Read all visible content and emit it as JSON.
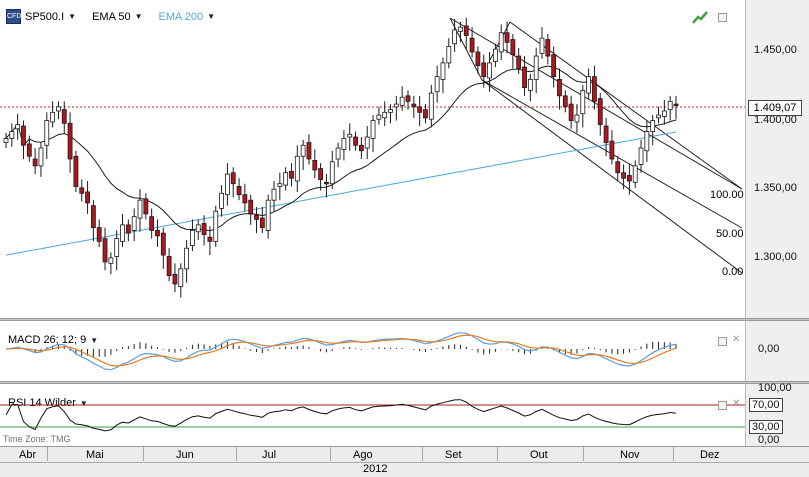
{
  "header": {
    "symbol": "SP500.I",
    "ema50": "EMA 50",
    "ema200": "EMA 200",
    "colors": {
      "ema50": "#1a1a1a",
      "ema200": "#4ea8dc",
      "bull": "#ffffff",
      "bear": "#b0161c"
    }
  },
  "price_axis": {
    "ticks": [
      "1.450,00",
      "1.400,00",
      "1.350,00",
      "1.300,00"
    ],
    "last_price": "1.409,07"
  },
  "fib_labels": [
    "100.00",
    "50.00",
    "0.00"
  ],
  "macd": {
    "label": "MACD 26; 12; 9",
    "tick": "0,00",
    "colors": {
      "macd": "#5d9fd6",
      "signal": "#e07f2a",
      "fill": "#b6dcef"
    }
  },
  "rsi": {
    "label": "RSI 14 Wilder",
    "ticks": [
      "100,00",
      "70,00",
      "30,00",
      "0,00"
    ],
    "colors": {
      "upper": "#a32020",
      "lower": "#4a9a4a"
    }
  },
  "time_axis": {
    "months": [
      "Abr",
      "Mai",
      "Jun",
      "Jul",
      "Ago",
      "Set",
      "Out",
      "Nov",
      "Dez"
    ],
    "year": "2012",
    "time_zone": "Time Zone: TMG"
  },
  "chart_data": {
    "type": "candlestick",
    "close_approx": [
      1385,
      1390,
      1395,
      1380,
      1372,
      1365,
      1378,
      1398,
      1404,
      1408,
      1396,
      1370,
      1350,
      1345,
      1338,
      1320,
      1310,
      1295,
      1298,
      1312,
      1322,
      1316,
      1328,
      1340,
      1330,
      1318,
      1314,
      1300,
      1285,
      1279,
      1290,
      1305,
      1318,
      1322,
      1315,
      1310,
      1332,
      1345,
      1359,
      1352,
      1344,
      1338,
      1330,
      1326,
      1320,
      1340,
      1348,
      1352,
      1360,
      1356,
      1372,
      1380,
      1370,
      1362,
      1355,
      1352,
      1368,
      1378,
      1385,
      1388,
      1380,
      1376,
      1386,
      1398,
      1402,
      1404,
      1406,
      1410,
      1415,
      1412,
      1408,
      1404,
      1400,
      1418,
      1430,
      1440,
      1452,
      1464,
      1466,
      1460,
      1448,
      1438,
      1430,
      1440,
      1450,
      1462,
      1455,
      1446,
      1436,
      1422,
      1428,
      1445,
      1458,
      1445,
      1430,
      1416,
      1408,
      1398,
      1402,
      1420,
      1430,
      1412,
      1395,
      1382,
      1370,
      1360,
      1356,
      1354,
      1365,
      1378,
      1390,
      1398,
      1402,
      1405,
      1412,
      1409
    ],
    "ylim": [
      1260,
      1480
    ]
  }
}
